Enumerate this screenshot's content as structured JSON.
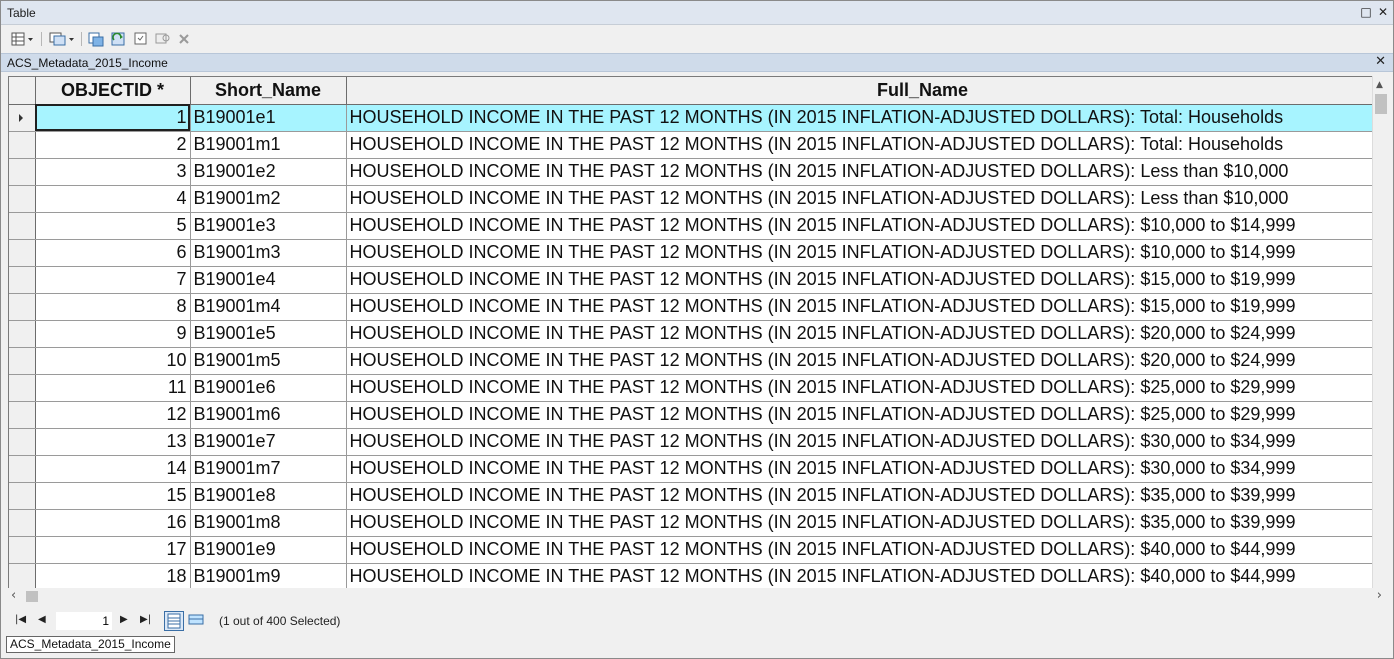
{
  "window": {
    "title": "Table"
  },
  "table_tab": {
    "name": "ACS_Metadata_2015_Income"
  },
  "columns": [
    "OBJECTID *",
    "Short_Name",
    "Full_Name"
  ],
  "rows": [
    {
      "id": "1",
      "short": "B19001e1",
      "full": "HOUSEHOLD INCOME IN THE PAST 12 MONTHS (IN 2015 INFLATION-ADJUSTED DOLLARS): Total: Households"
    },
    {
      "id": "2",
      "short": "B19001m1",
      "full": "HOUSEHOLD INCOME IN THE PAST 12 MONTHS (IN 2015 INFLATION-ADJUSTED DOLLARS): Total: Households"
    },
    {
      "id": "3",
      "short": "B19001e2",
      "full": "HOUSEHOLD INCOME IN THE PAST 12 MONTHS (IN 2015 INFLATION-ADJUSTED DOLLARS): Less than $10,000"
    },
    {
      "id": "4",
      "short": "B19001m2",
      "full": "HOUSEHOLD INCOME IN THE PAST 12 MONTHS (IN 2015 INFLATION-ADJUSTED DOLLARS): Less than $10,000"
    },
    {
      "id": "5",
      "short": "B19001e3",
      "full": "HOUSEHOLD INCOME IN THE PAST 12 MONTHS (IN 2015 INFLATION-ADJUSTED DOLLARS): $10,000 to $14,999"
    },
    {
      "id": "6",
      "short": "B19001m3",
      "full": "HOUSEHOLD INCOME IN THE PAST 12 MONTHS (IN 2015 INFLATION-ADJUSTED DOLLARS): $10,000 to $14,999"
    },
    {
      "id": "7",
      "short": "B19001e4",
      "full": "HOUSEHOLD INCOME IN THE PAST 12 MONTHS (IN 2015 INFLATION-ADJUSTED DOLLARS): $15,000 to $19,999"
    },
    {
      "id": "8",
      "short": "B19001m4",
      "full": "HOUSEHOLD INCOME IN THE PAST 12 MONTHS (IN 2015 INFLATION-ADJUSTED DOLLARS): $15,000 to $19,999"
    },
    {
      "id": "9",
      "short": "B19001e5",
      "full": "HOUSEHOLD INCOME IN THE PAST 12 MONTHS (IN 2015 INFLATION-ADJUSTED DOLLARS): $20,000 to $24,999"
    },
    {
      "id": "10",
      "short": "B19001m5",
      "full": "HOUSEHOLD INCOME IN THE PAST 12 MONTHS (IN 2015 INFLATION-ADJUSTED DOLLARS): $20,000 to $24,999"
    },
    {
      "id": "11",
      "short": "B19001e6",
      "full": "HOUSEHOLD INCOME IN THE PAST 12 MONTHS (IN 2015 INFLATION-ADJUSTED DOLLARS): $25,000 to $29,999"
    },
    {
      "id": "12",
      "short": "B19001m6",
      "full": "HOUSEHOLD INCOME IN THE PAST 12 MONTHS (IN 2015 INFLATION-ADJUSTED DOLLARS): $25,000 to $29,999"
    },
    {
      "id": "13",
      "short": "B19001e7",
      "full": "HOUSEHOLD INCOME IN THE PAST 12 MONTHS (IN 2015 INFLATION-ADJUSTED DOLLARS): $30,000 to $34,999"
    },
    {
      "id": "14",
      "short": "B19001m7",
      "full": "HOUSEHOLD INCOME IN THE PAST 12 MONTHS (IN 2015 INFLATION-ADJUSTED DOLLARS): $30,000 to $34,999"
    },
    {
      "id": "15",
      "short": "B19001e8",
      "full": "HOUSEHOLD INCOME IN THE PAST 12 MONTHS (IN 2015 INFLATION-ADJUSTED DOLLARS): $35,000 to $39,999"
    },
    {
      "id": "16",
      "short": "B19001m8",
      "full": "HOUSEHOLD INCOME IN THE PAST 12 MONTHS (IN 2015 INFLATION-ADJUSTED DOLLARS): $35,000 to $39,999"
    },
    {
      "id": "17",
      "short": "B19001e9",
      "full": "HOUSEHOLD INCOME IN THE PAST 12 MONTHS (IN 2015 INFLATION-ADJUSTED DOLLARS): $40,000 to $44,999"
    },
    {
      "id": "18",
      "short": "B19001m9",
      "full": "HOUSEHOLD INCOME IN THE PAST 12 MONTHS (IN 2015 INFLATION-ADJUSTED DOLLARS): $40,000 to $44,999"
    }
  ],
  "selected_row": 0,
  "navigator": {
    "record": "1",
    "status": "(1 out of 400 Selected)"
  },
  "bottom_tab": {
    "name": "ACS_Metadata_2015_Income"
  },
  "colors": {
    "selection": "#a7f4ff",
    "title_bar": "#dfe6f0",
    "tab_header": "#cfdbea"
  },
  "icons": [
    "table-options-icon",
    "related-tables-icon",
    "select-by-attributes-icon",
    "switch-selection-icon",
    "clear-selection-icon",
    "zoom-to-selected-icon",
    "delete-selected-icon",
    "maximize-icon",
    "close-icon"
  ]
}
